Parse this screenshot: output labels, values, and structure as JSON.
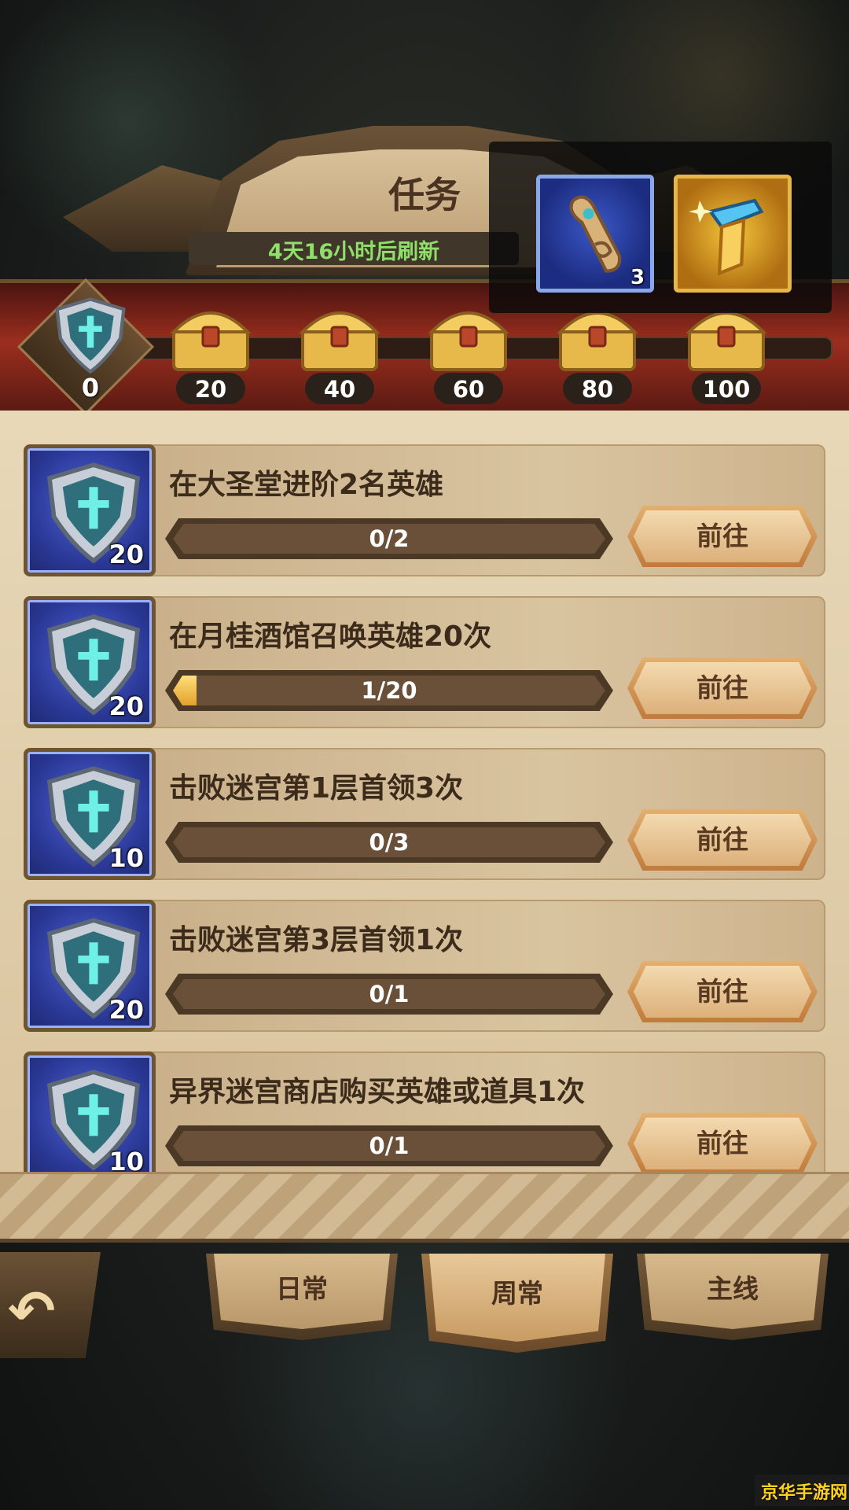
{
  "header": {
    "title": "任务",
    "refresh_text": "4天16小时后刷新"
  },
  "reward_preview": {
    "items": [
      {
        "icon": "scroll-icon",
        "count": "3"
      },
      {
        "icon": "amulet-icon",
        "count": ""
      }
    ]
  },
  "progress": {
    "current_points": "0",
    "milestones": [
      "20",
      "40",
      "60",
      "80",
      "100"
    ]
  },
  "tasks": [
    {
      "title": "在大圣堂进阶2名英雄",
      "points": "20",
      "progress_text": "0/2",
      "progress_fraction": 0,
      "button": "前往"
    },
    {
      "title": "在月桂酒馆召唤英雄20次",
      "points": "20",
      "progress_text": "1/20",
      "progress_fraction": 0.05,
      "button": "前往"
    },
    {
      "title": "击败迷宫第1层首领3次",
      "points": "10",
      "progress_text": "0/3",
      "progress_fraction": 0,
      "button": "前往"
    },
    {
      "title": "击败迷宫第3层首领1次",
      "points": "20",
      "progress_text": "0/1",
      "progress_fraction": 0,
      "button": "前往"
    },
    {
      "title": "异界迷宫商店购买英雄或道具1次",
      "points": "10",
      "progress_text": "0/1",
      "progress_fraction": 0,
      "button": "前往"
    }
  ],
  "tabs": [
    {
      "label": "日常",
      "active": false
    },
    {
      "label": "周常",
      "active": true
    },
    {
      "label": "主线",
      "active": false
    }
  ],
  "watermark": "京华手游网",
  "colors": {
    "refresh_text": "#8ee06a",
    "progress_fill": "#f0b640",
    "panel": "#e0cba8"
  }
}
